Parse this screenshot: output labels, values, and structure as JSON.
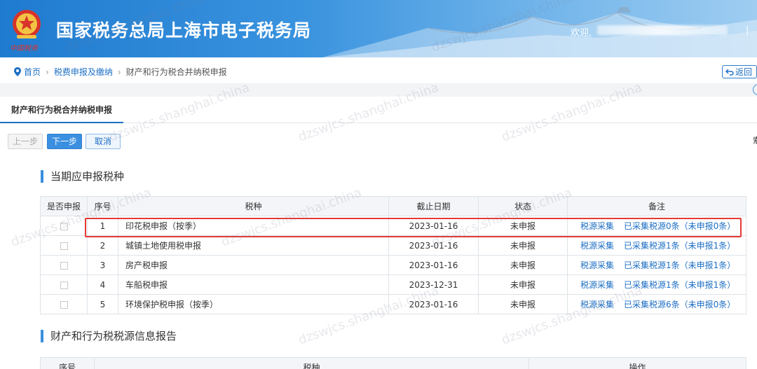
{
  "header": {
    "title": "国家税务总局上海市电子税务局",
    "brand_sub": "中国税务",
    "welcome": "欢迎,",
    "separator": "|"
  },
  "breadcrumb": {
    "home": "首页",
    "level1": "税费申报及缴纳",
    "current": "财产和行为税合并纳税申报"
  },
  "back_label": "返回",
  "tab_label": "财产和行为税合并纳税申报",
  "toolbar": {
    "prev": "上一步",
    "next": "下一步",
    "cancel": "取消"
  },
  "side_text": "索",
  "section1": {
    "title": "当期应申报税种",
    "headers": [
      "是否申报",
      "序号",
      "税种",
      "截止日期",
      "状态",
      "备注"
    ],
    "rows": [
      {
        "no": "1",
        "tax": "印花税申报（按季）",
        "deadline": "2023-01-16",
        "status": "未申报",
        "collect": "税源采集",
        "collected": "已采集税源0条（未申报0条）"
      },
      {
        "no": "2",
        "tax": "城镇土地使用税申报",
        "deadline": "2023-01-16",
        "status": "未申报",
        "collect": "税源采集",
        "collected": "已采集税源1条（未申报1条）"
      },
      {
        "no": "3",
        "tax": "房产税申报",
        "deadline": "2023-01-16",
        "status": "未申报",
        "collect": "税源采集",
        "collected": "已采集税源1条（未申报1条）"
      },
      {
        "no": "4",
        "tax": "车船税申报",
        "deadline": "2023-12-31",
        "status": "未申报",
        "collect": "税源采集",
        "collected": "已采集税源1条（未申报1条）"
      },
      {
        "no": "5",
        "tax": "环境保护税申报（按季）",
        "deadline": "2023-01-16",
        "status": "未申报",
        "collect": "税源采集",
        "collected": "已采集税源6条（未申报0条）"
      }
    ]
  },
  "section2": {
    "title": "财产和行为税税源信息报告",
    "headers": [
      "序号",
      "税种",
      "操作"
    ]
  },
  "watermark": "dzswjcs.shanghai.china",
  "colors": {
    "accent": "#1d6fc4",
    "highlight": "#e53935",
    "header_start": "#1f7bd0"
  }
}
